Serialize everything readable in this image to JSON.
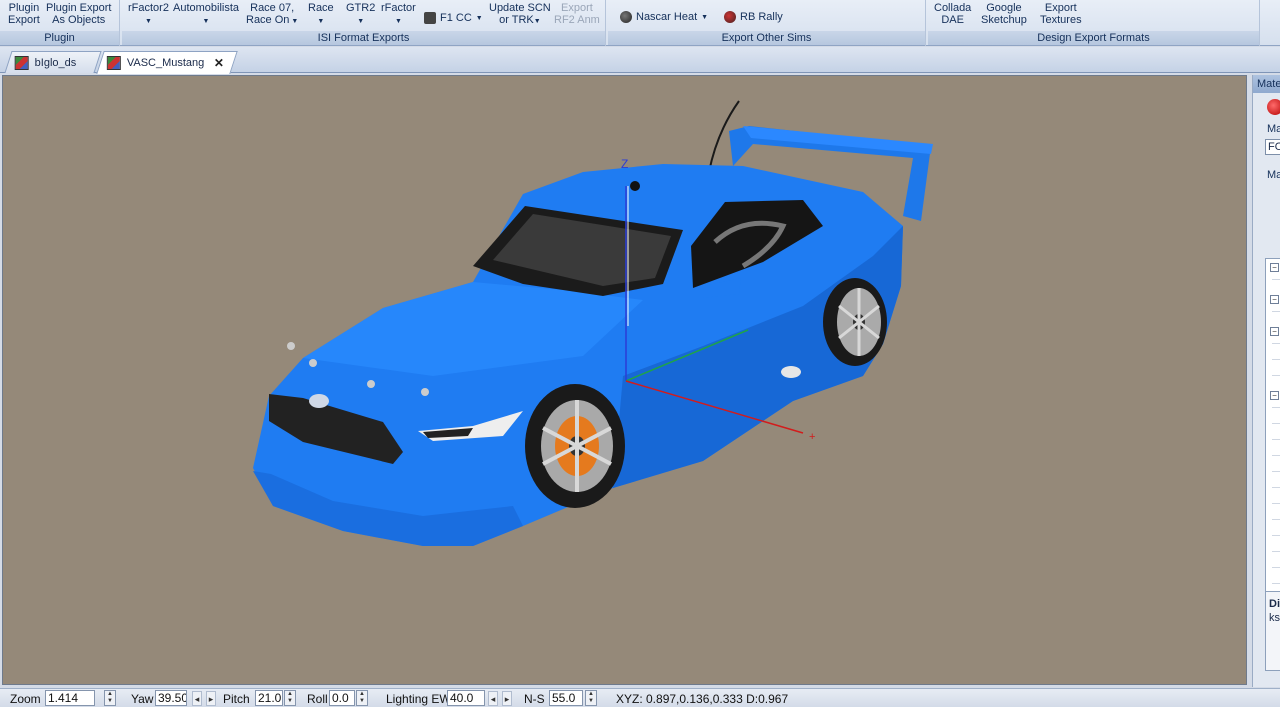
{
  "ribbon": {
    "groups": [
      {
        "label": "Plugin",
        "buttons": [
          "Plugin\nExport",
          "Plugin Export\nAs Objects"
        ]
      },
      {
        "label": "ISI Format Exports",
        "buttons": [
          "rFactor2",
          "Automobilista",
          "Race 07,\nRace On",
          "Race",
          "GTR2",
          "rFactor",
          "F1 CC",
          "Update SCN\nor TRK",
          "Export\nRF2 Anm"
        ]
      },
      {
        "label": "Export Other Sims",
        "buttons": [
          "Nascar Heat",
          "RB Rally"
        ]
      },
      {
        "label": "Design Export Formats",
        "buttons": [
          "Collada\nDAE",
          "Google\nSketchup",
          "Export\nTextures"
        ]
      }
    ]
  },
  "tabs": [
    {
      "label": "bIglo_ds",
      "active": false
    },
    {
      "label": "VASC_Mustang",
      "active": true
    }
  ],
  "viewport": {
    "background": "#958979",
    "car_color": "#1f7cf2",
    "axis_labels": {
      "z": "Z"
    }
  },
  "right_panel": {
    "title": "Mate",
    "label1": "Mat",
    "field_value": "FO",
    "label2": "Mat",
    "info_title": "Di",
    "info_text": "ks"
  },
  "status": {
    "zoom_label": "Zoom",
    "zoom_value": "1.414",
    "yaw_label": "Yaw",
    "yaw_value": "39.50",
    "pitch_label": "Pitch",
    "pitch_value": "21.0",
    "roll_label": "Roll",
    "roll_value": "0.0",
    "lighting_ew_label": "Lighting EW",
    "lighting_ew_value": "40.0",
    "ns_label": "N-S",
    "ns_value": "55.0",
    "xyz_readout": "XYZ: 0.897,0.136,0.333  D:0.967"
  }
}
